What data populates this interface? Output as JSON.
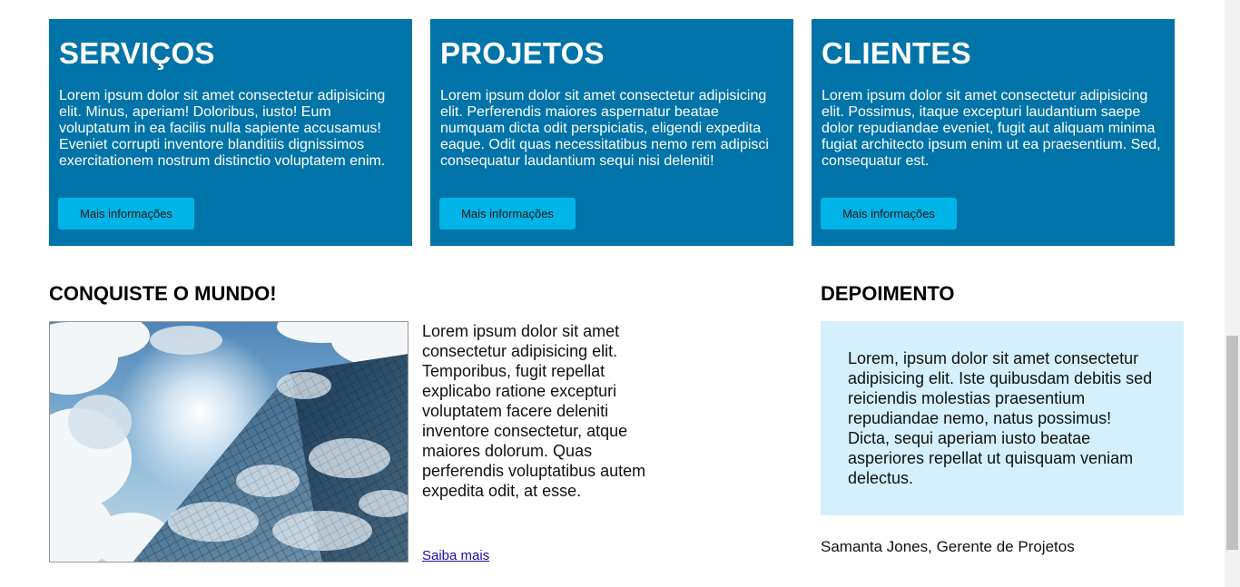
{
  "cards": [
    {
      "title": "SERVIÇOS",
      "text": "Lorem ipsum dolor sit amet consectetur adipisicing elit. Minus, aperiam! Doloribus, iusto! Eum voluptatum in ea facilis nulla sapiente accusamus! Eveniet corrupti inventore blanditiis dignissimos exercitationem nostrum distinctio voluptatem enim.",
      "button": "Mais informações"
    },
    {
      "title": "PROJETOS",
      "text": "Lorem ipsum dolor sit amet consectetur adipisicing elit. Perferendis maiores aspernatur beatae numquam dicta odit perspiciatis, eligendi expedita eaque. Odit quas necessitatibus nemo rem adipisci consequatur laudantium sequi nisi deleniti!",
      "button": "Mais informações"
    },
    {
      "title": "CLIENTES",
      "text": "Lorem ipsum dolor sit amet consectetur adipisicing elit. Possimus, itaque excepturi laudantium saepe dolor repudiandae eveniet, fugit aut aliquam minima fugiat architecto ipsum enim ut ea praesentium. Sed, consequatur est.",
      "button": "Mais informações"
    }
  ],
  "conquer": {
    "title": "CONQUISTE O MUNDO!",
    "text": "Lorem ipsum dolor sit amet consectetur adipisicing elit. Temporibus, fugit repellat explicabo ratione excepturi voluptatem facere deleniti inventore consectetur, atque maiores dolorum. Quas perferendis voluptatibus autem expedita odit, at esse.",
    "link": "Saiba mais"
  },
  "testimonial": {
    "title": "DEPOIMENTO",
    "quote": "Lorem, ipsum dolor sit amet consectetur adipisicing elit. Iste quibusdam debitis sed reiciendis molestias praesentium repudiandae nemo, natus possimus! Dicta, sequi aperiam iusto beatae asperiores repellat ut quisquam veniam delectus.",
    "author": "Samanta Jones, Gerente de Projetos"
  },
  "colors": {
    "card_bg": "#0074a8",
    "button_bg": "#00b4e8",
    "quote_bg": "#d4f0fc"
  }
}
